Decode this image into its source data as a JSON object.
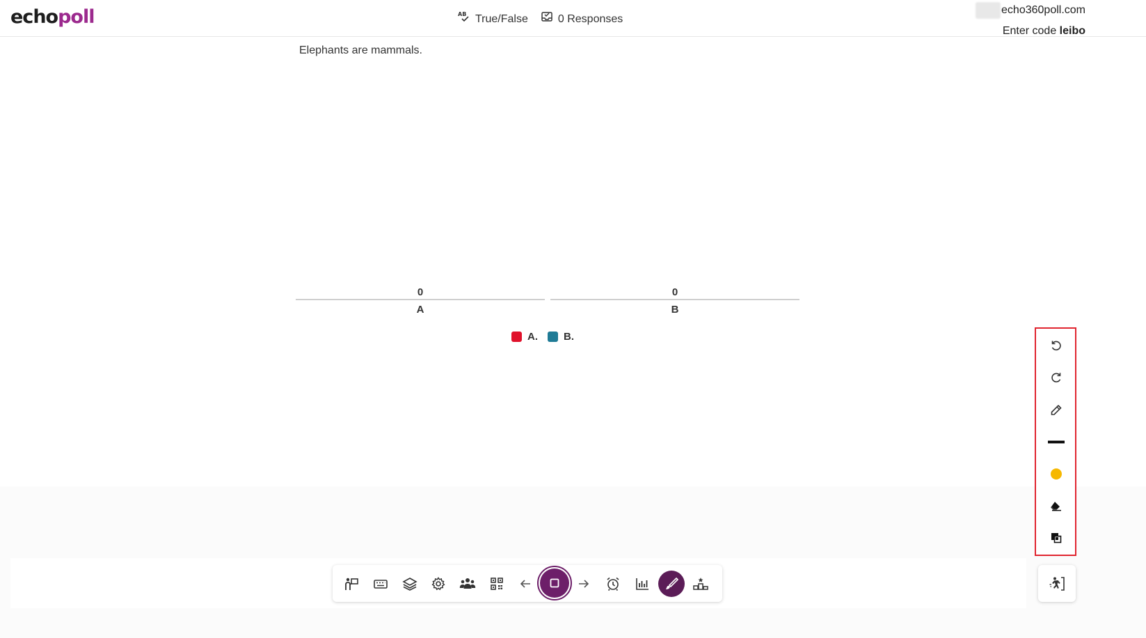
{
  "header": {
    "logo_part1": "echo",
    "logo_part2": "poll",
    "question_type": "True/False",
    "responses": "0 Responses",
    "join_url": "echo360poll.com",
    "join_prefix": "Enter code ",
    "join_code": "leibo"
  },
  "question": {
    "text": "Elephants are mammals."
  },
  "chart_data": {
    "type": "bar",
    "categories": [
      "A",
      "B"
    ],
    "values": [
      0,
      0
    ],
    "legend": [
      {
        "label": "A.",
        "color": "#e0112b"
      },
      {
        "label": "B.",
        "color": "#1f7b96"
      }
    ],
    "legend_position": "bottom-center",
    "grid": false
  },
  "toolbar": {
    "items": [
      {
        "name": "presenter-view-icon"
      },
      {
        "name": "keyboard-icon"
      },
      {
        "name": "layers-icon"
      },
      {
        "name": "settings-gear-icon"
      },
      {
        "name": "participants-icon"
      },
      {
        "name": "qr-code-icon"
      },
      {
        "name": "previous-arrow-icon"
      },
      {
        "name": "stop-poll-icon"
      },
      {
        "name": "next-arrow-icon"
      },
      {
        "name": "timer-alarm-icon"
      },
      {
        "name": "results-chart-icon"
      },
      {
        "name": "annotate-brush-icon"
      },
      {
        "name": "leaderboard-icon"
      }
    ],
    "accent_color": "#6d1f69"
  },
  "annotation_tools": {
    "items": [
      {
        "name": "undo-icon"
      },
      {
        "name": "redo-icon"
      },
      {
        "name": "pen-icon"
      },
      {
        "name": "line-thickness-icon"
      },
      {
        "name": "color-swatch-icon",
        "color": "#f6b800"
      },
      {
        "name": "eraser-icon"
      },
      {
        "name": "clear-layers-icon"
      }
    ],
    "highlight_color": "#e0242f"
  },
  "exit_button": {
    "name": "exit-presentation-icon"
  }
}
